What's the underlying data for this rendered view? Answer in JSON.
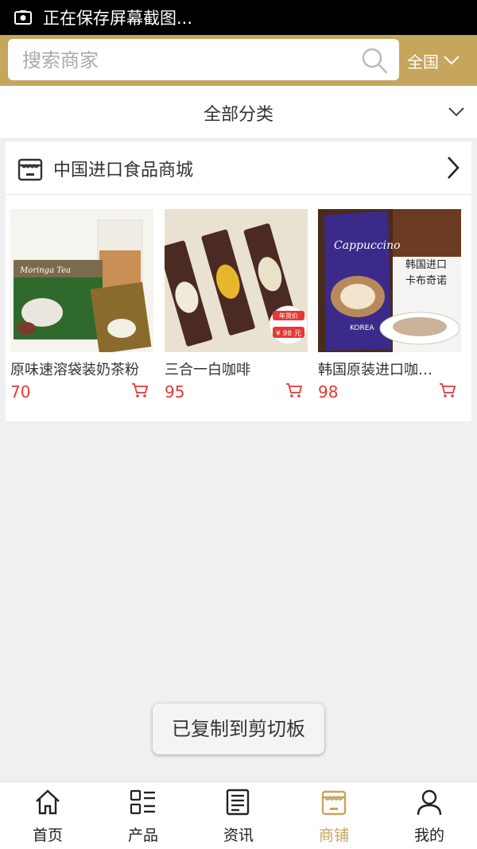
{
  "status_bar": {
    "message": "正在保存屏幕截图..."
  },
  "search": {
    "placeholder": "搜索商家"
  },
  "region": {
    "label": "全国"
  },
  "category": {
    "label": "全部分类"
  },
  "store": {
    "name": "中国进口食品商城"
  },
  "products": [
    {
      "name": "原味速溶袋装奶茶粉",
      "price": "70",
      "image_text": "Moringa Tea"
    },
    {
      "name": "三合一白咖啡",
      "price": "95",
      "badge_line1": "年货价",
      "badge_price": "¥ 98 元"
    },
    {
      "name": "韩国原装进口咖…",
      "price": "98",
      "image_brand": "Cappuccino",
      "image_caption_1": "韩国进口",
      "image_caption_2": "卡布奇诺",
      "image_korea": "KOREA"
    }
  ],
  "toast": {
    "text": "已复制到剪切板"
  },
  "tabs": [
    {
      "label": "首页",
      "icon": "home-icon"
    },
    {
      "label": "产品",
      "icon": "grid-list-icon"
    },
    {
      "label": "资讯",
      "icon": "news-icon"
    },
    {
      "label": "商铺",
      "icon": "shop-icon"
    },
    {
      "label": "我的",
      "icon": "user-icon"
    }
  ],
  "colors": {
    "accent": "#c6a55d",
    "price": "#e53935",
    "statusbar": "#000000"
  }
}
